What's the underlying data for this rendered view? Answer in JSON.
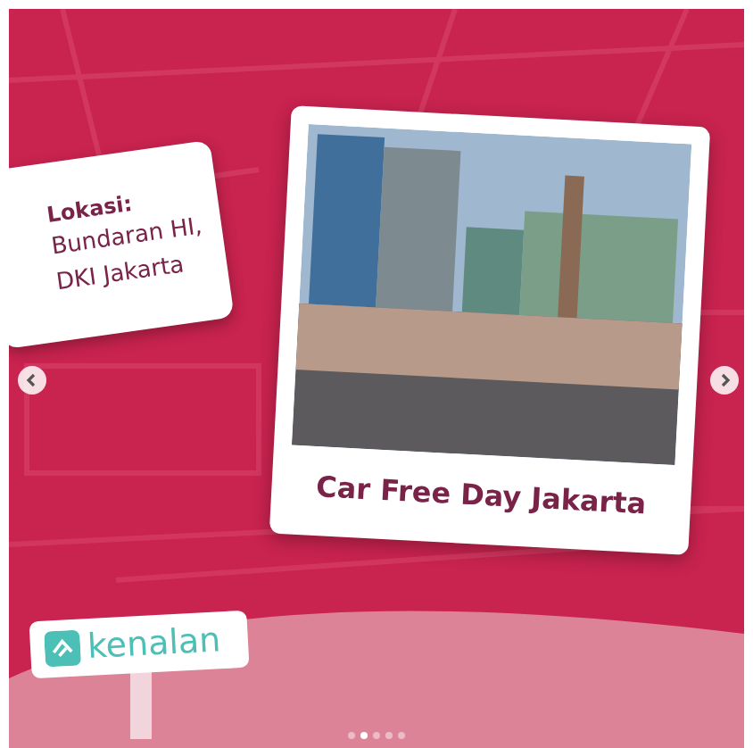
{
  "location_card": {
    "label": "Lokasi:",
    "lines": [
      "Bundaran HI,",
      "DKI Jakarta"
    ]
  },
  "photo_card": {
    "caption": "Car Free Day Jakarta"
  },
  "logo_sign": {
    "text": "kenalan"
  },
  "carousel": {
    "dots": [
      {
        "selected": false
      },
      {
        "selected": true
      },
      {
        "selected": false
      },
      {
        "selected": false
      },
      {
        "selected": false
      }
    ]
  }
}
